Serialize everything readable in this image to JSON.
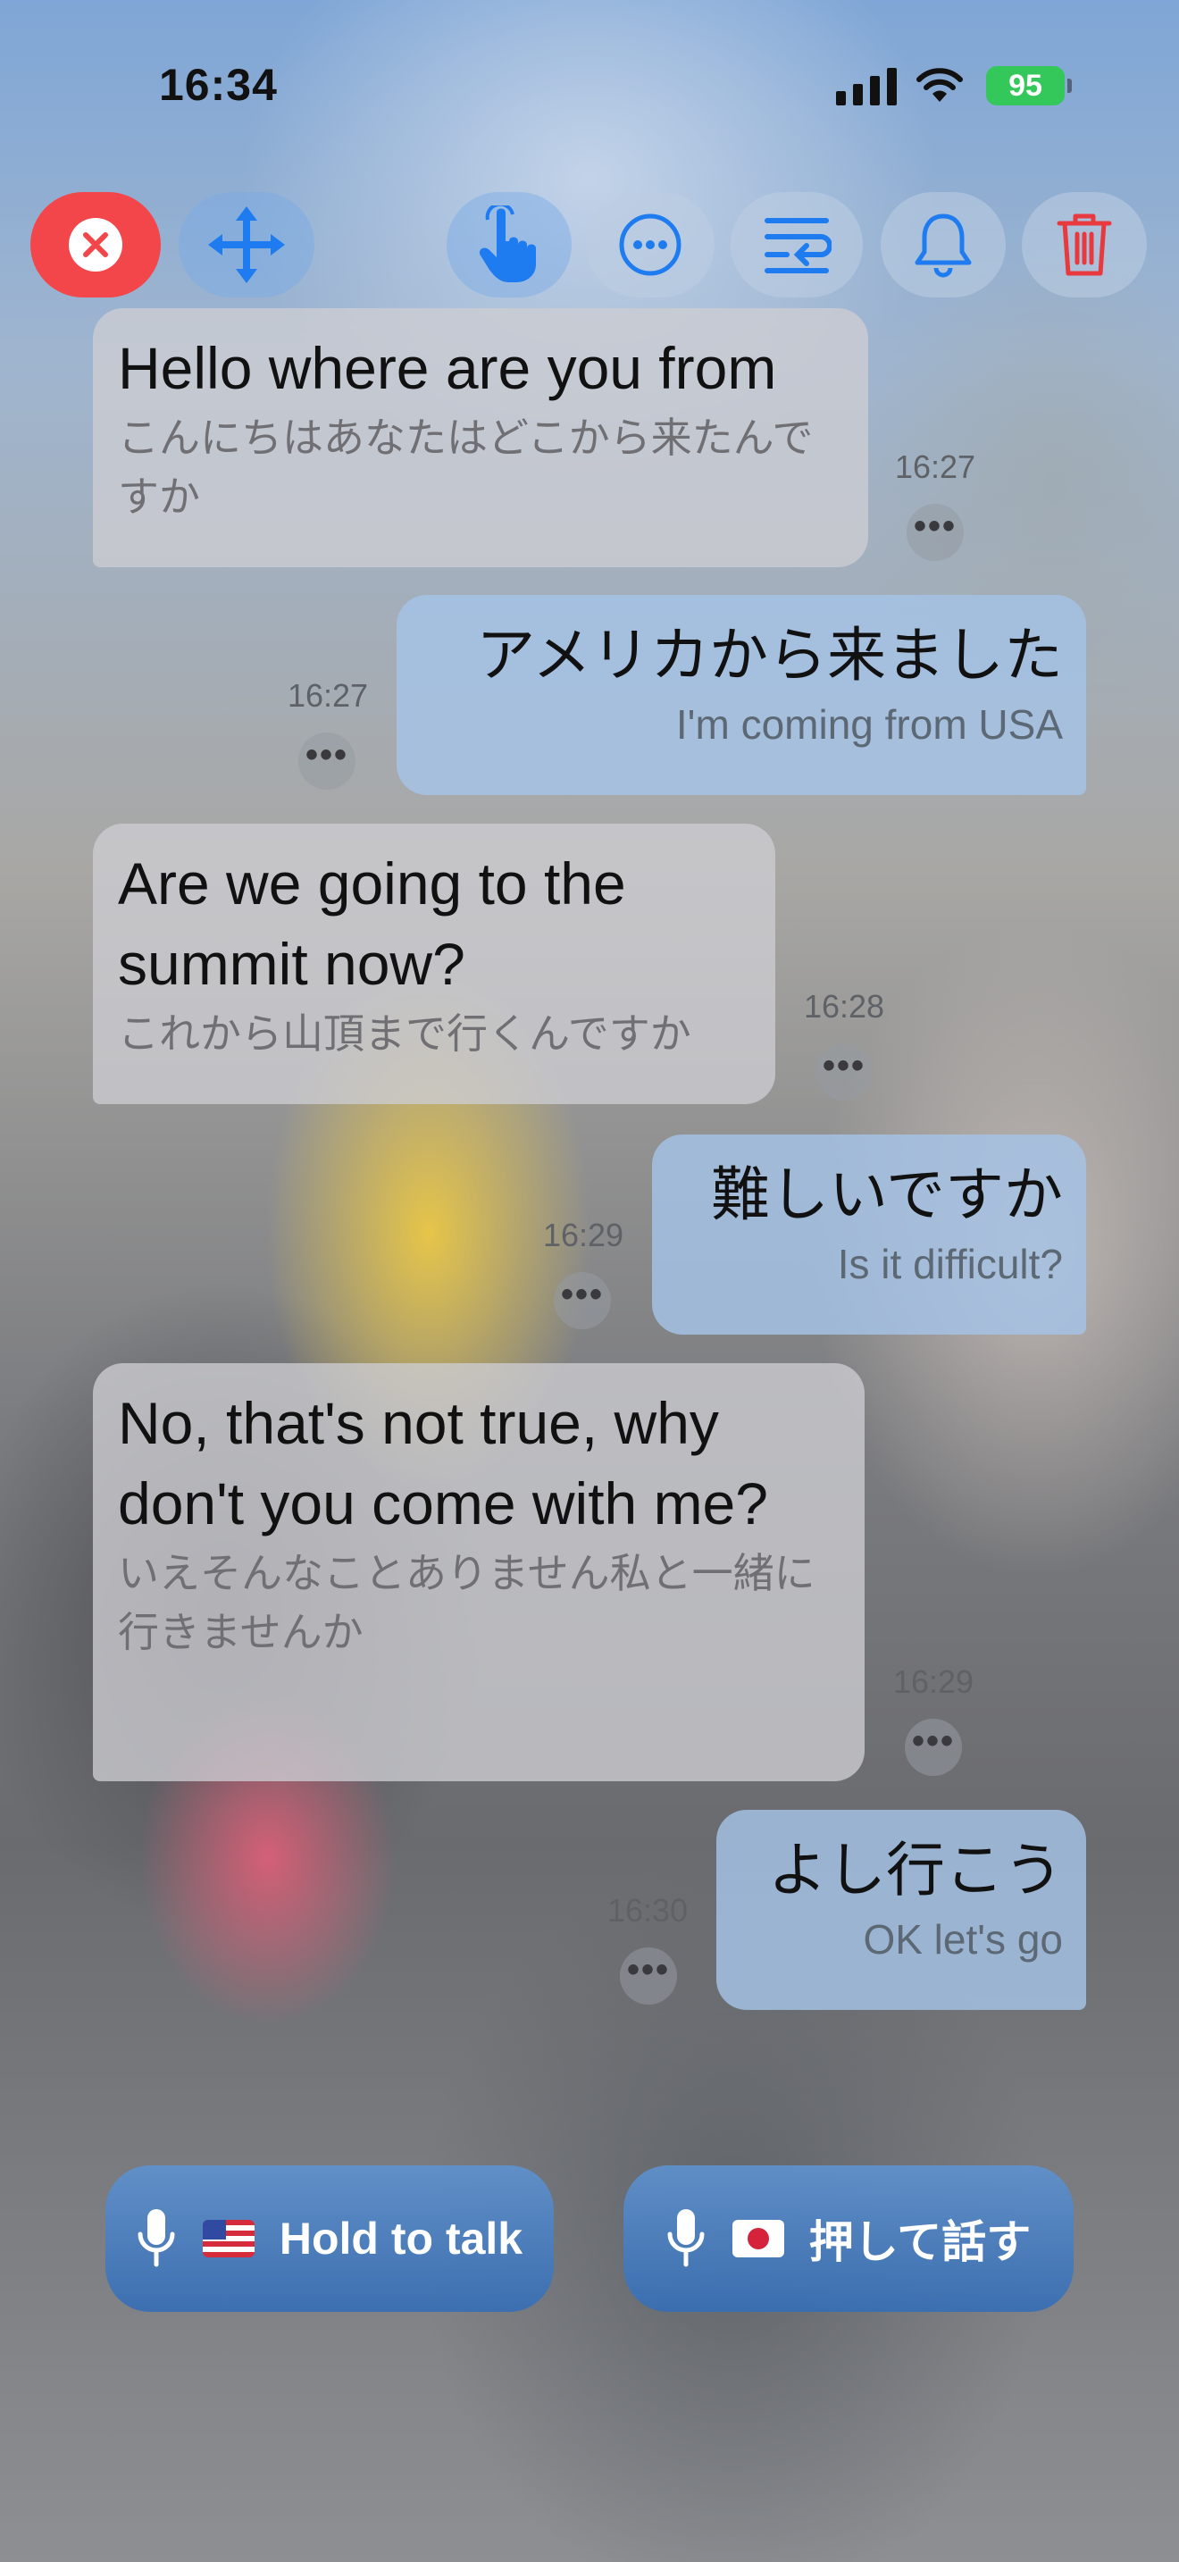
{
  "status_bar": {
    "time": "16:34",
    "battery": "95"
  },
  "toolbar": {
    "buttons": [
      {
        "name": "close",
        "icon": "close-icon"
      },
      {
        "name": "move",
        "icon": "move-arrows-icon"
      },
      {
        "name": "touch",
        "icon": "hand-pointer-icon"
      },
      {
        "name": "more",
        "icon": "ellipsis-circle-icon"
      },
      {
        "name": "text-wrap",
        "icon": "text-wrap-icon"
      },
      {
        "name": "notifications",
        "icon": "bell-icon"
      },
      {
        "name": "delete",
        "icon": "trash-icon"
      }
    ]
  },
  "messages": [
    {
      "side": "left",
      "primary": "Hello where are you from",
      "secondary": "こんにちはあなたはどこから来たんですか",
      "time": "16:27"
    },
    {
      "side": "right",
      "primary": "アメリカから来ました",
      "secondary": "I'm coming from USA",
      "time": "16:27"
    },
    {
      "side": "left",
      "primary": "Are we going to the summit now?",
      "secondary": "これから山頂まで行くんですか",
      "time": "16:28"
    },
    {
      "side": "right",
      "primary": "難しいですか",
      "secondary": "Is it difficult?",
      "time": "16:29"
    },
    {
      "side": "left",
      "primary": "No, that's not true, why don't you come with me?",
      "secondary": "いえそんなことありません私と一緒に行きませんか",
      "time": "16:29"
    },
    {
      "side": "right",
      "primary": "よし行こう",
      "secondary": "OK let's go",
      "time": "16:30"
    }
  ],
  "more_glyph": "•••",
  "talk_buttons": {
    "english": {
      "label": "Hold to talk",
      "flag": "US"
    },
    "japanese": {
      "label": "押して話す",
      "flag": "JP"
    }
  },
  "colors": {
    "accent_blue": "#1e7cf0",
    "close_red": "#f2464b",
    "trash_red": "#e8393f",
    "battery_green": "#34c759"
  }
}
